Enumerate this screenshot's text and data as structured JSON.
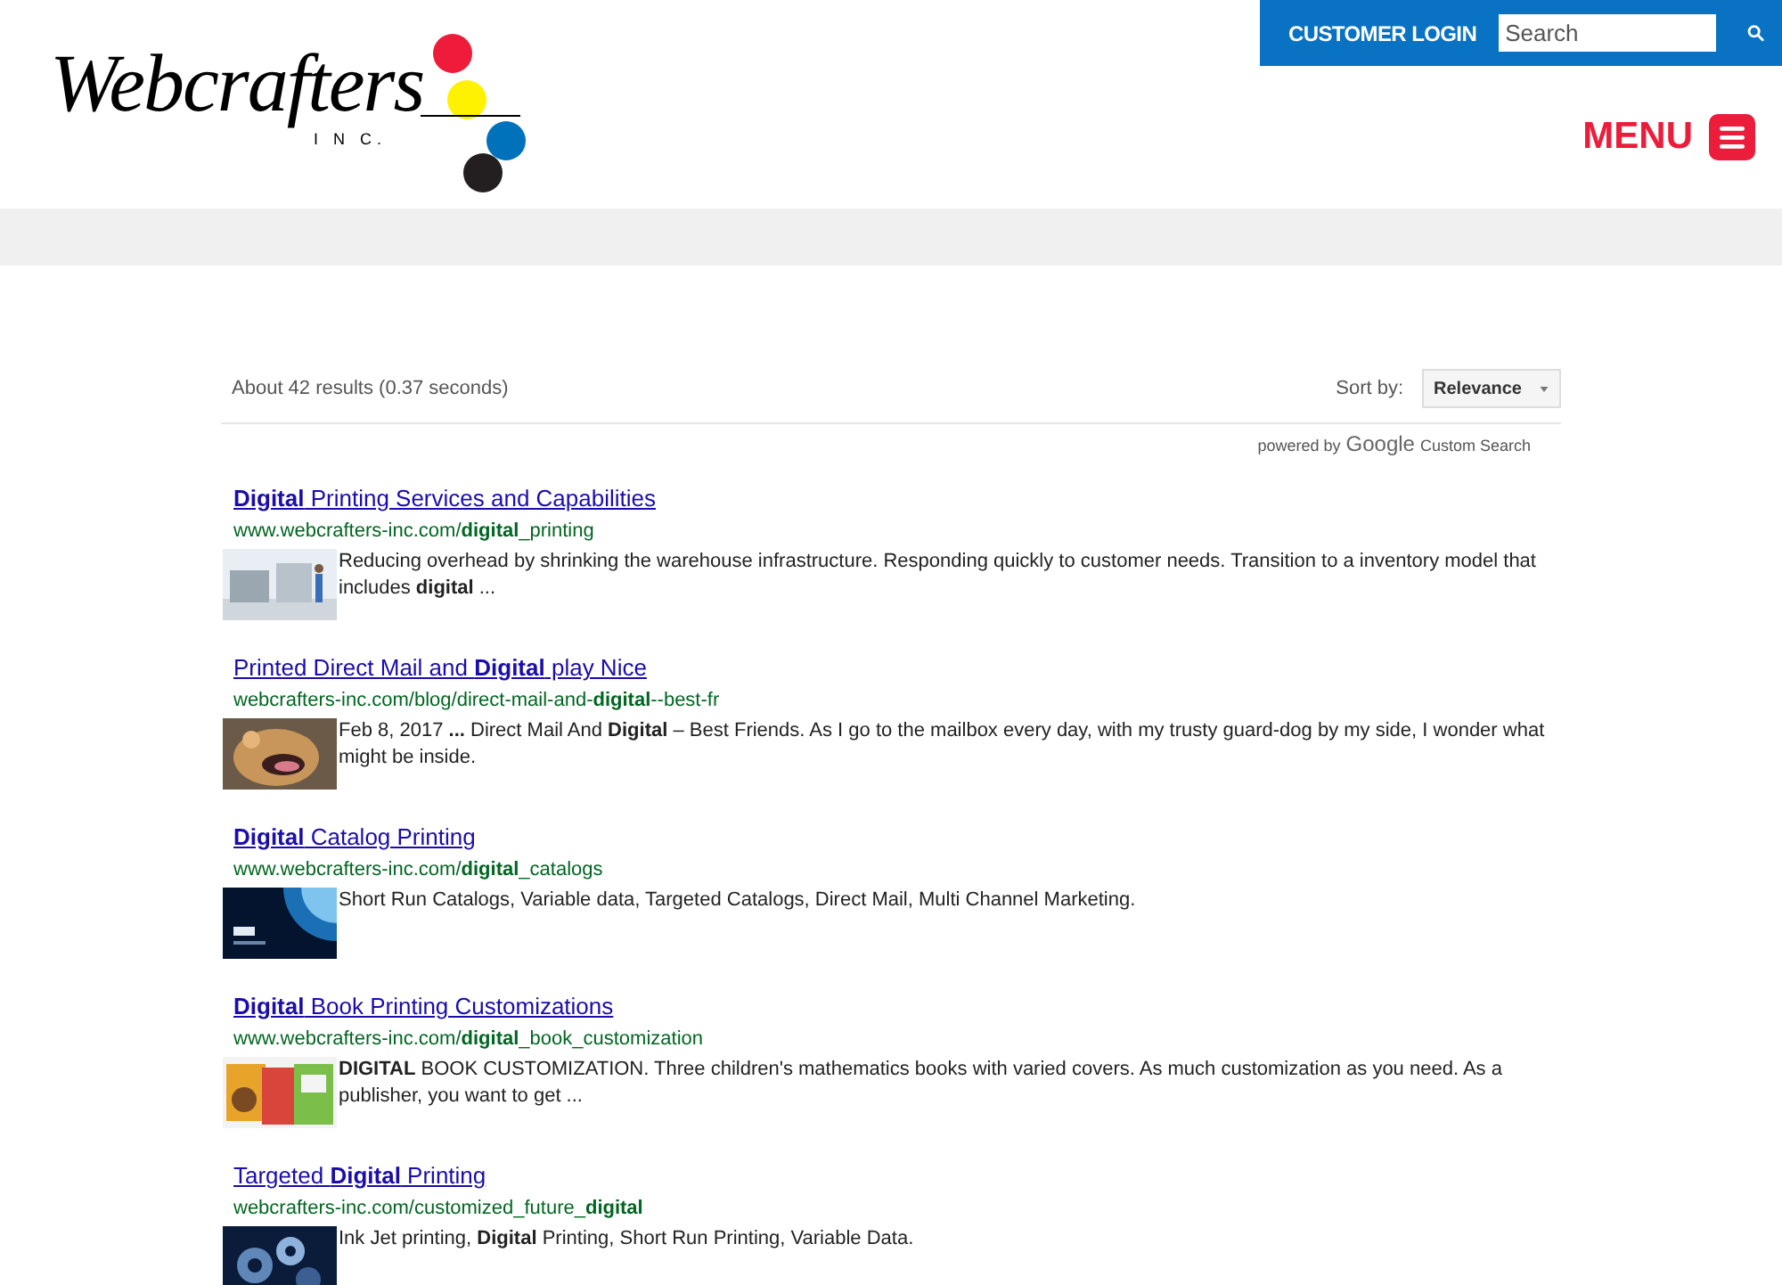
{
  "header": {
    "logo": {
      "script": "Webcrafters",
      "suffix": "I N C."
    },
    "login": "CUSTOMER LOGIN",
    "search": {
      "placeholder": "Search"
    },
    "menu": "MENU"
  },
  "results_bar": {
    "summary": "About 42 results (0.37 seconds)",
    "sort_label": "Sort by:",
    "sort_value": "Relevance",
    "powered_by": "powered by",
    "google": "Google",
    "custom_search": "Custom Search"
  },
  "results": [
    {
      "title": "**Digital** Printing Services and Capabilities",
      "url": "www.webcrafters-inc.com/**digital**_printing",
      "snippet": "Reducing overhead by shrinking the warehouse infrastructure. Responding quickly to customer needs. Transition to a inventory model that includes **digital** ..."
    },
    {
      "title": "Printed Direct Mail and **Digital** play Nice",
      "url": "webcrafters-inc.com/blog/direct-mail-and-**digital**--best-fr",
      "snippet": "Feb 8, 2017 **...** Direct Mail And **Digital** – Best Friends. As I go to the mailbox every day, with my trusty guard-dog by my side, I wonder what might be inside."
    },
    {
      "title": "**Digital** Catalog Printing",
      "url": "www.webcrafters-inc.com/**digital**_catalogs",
      "snippet": "Short Run Catalogs, Variable data, Targeted Catalogs, Direct Mail, Multi Channel Marketing."
    },
    {
      "title": "**Digital** Book Printing Customizations",
      "url": "www.webcrafters-inc.com/**digital**_book_customization",
      "snippet": "**DIGITAL** BOOK CUSTOMIZATION. Three children's mathematics books with varied covers. As much customization as you need. As a publisher, you want to get ..."
    },
    {
      "title": "Targeted **Digital** Printing",
      "url": "webcrafters-inc.com/customized_future_**digital**",
      "snippet": "Ink Jet printing, **Digital** Printing, Short Run Printing, Variable Data."
    }
  ]
}
